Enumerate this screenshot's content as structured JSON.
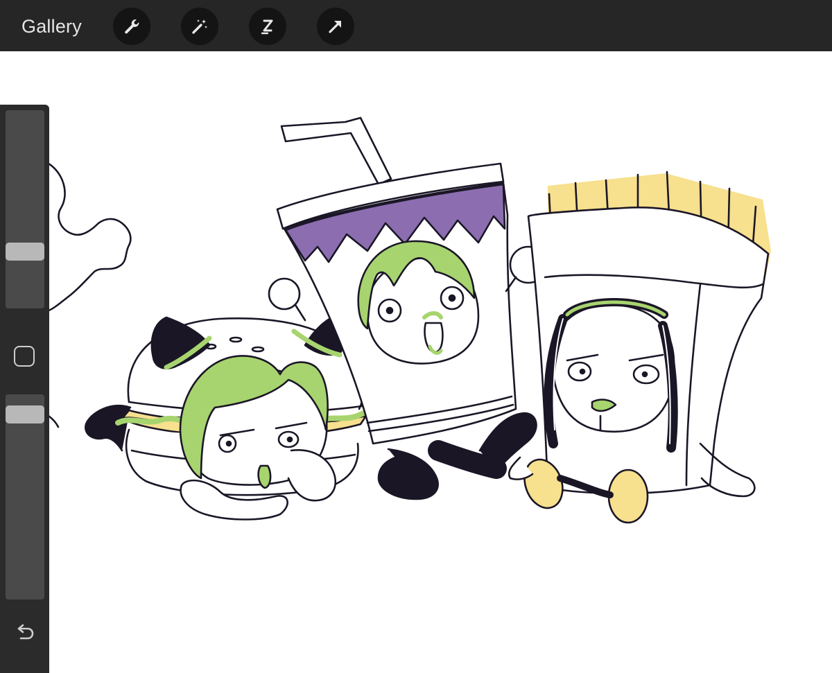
{
  "toolbar": {
    "gallery_label": "Gallery",
    "tools": [
      {
        "name": "actions",
        "icon": "wrench-icon"
      },
      {
        "name": "adjustments",
        "icon": "magic-wand-icon"
      },
      {
        "name": "selection",
        "icon": "selection-s-icon"
      },
      {
        "name": "transform",
        "icon": "arrow-cursor-icon"
      }
    ]
  },
  "sidebar": {
    "brush_size": 0.25,
    "opacity": 0.97,
    "modify_icon": "square-icon",
    "undo_icon": "undo-arrow-icon"
  },
  "colors": {
    "toolbar_bg": "#262626",
    "sidebar_bg": "#2b2b2b",
    "hair_green": "#a7d46f",
    "cup_purple": "#8b6db0",
    "fries_yellow": "#f7e08e",
    "ink": "#1b1626"
  }
}
